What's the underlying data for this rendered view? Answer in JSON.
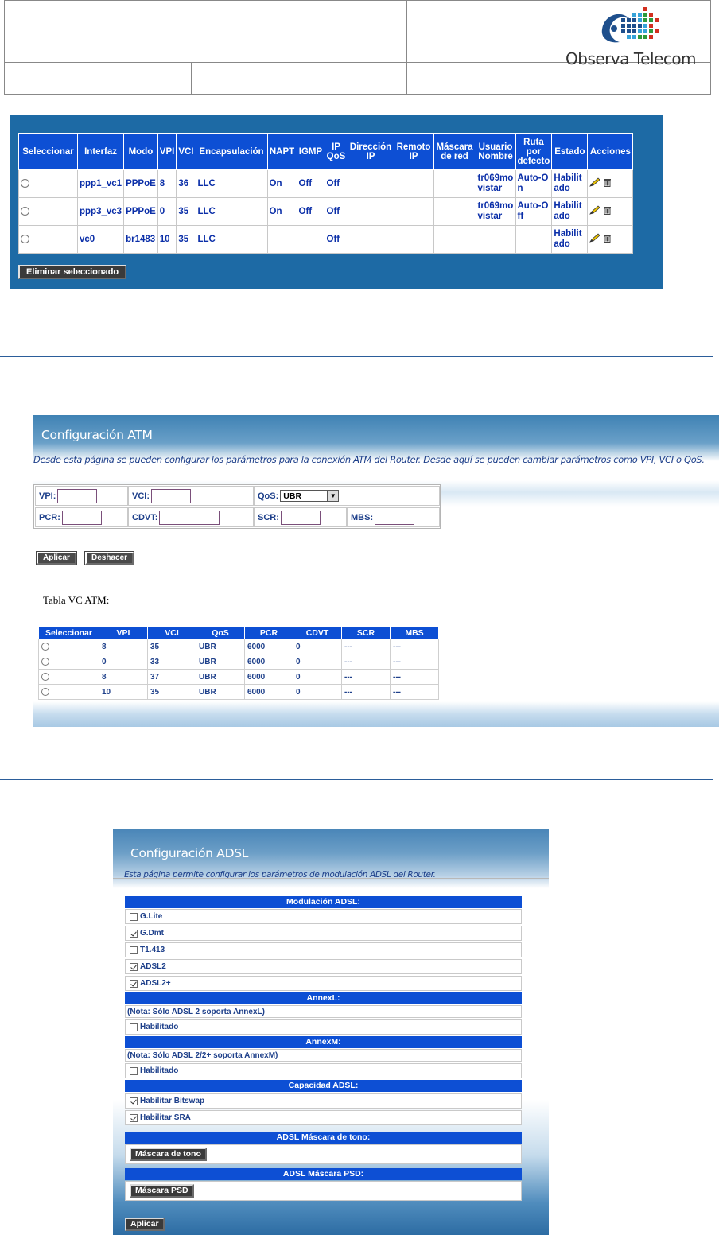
{
  "header": {
    "logo_text": "Observa Telecom",
    "colors": {
      "logo_blue": "#1e4f8c",
      "logo_red": "#d32f1f",
      "logo_green": "#2e9a3a",
      "logo_cyan": "#36a3d9"
    }
  },
  "wan": {
    "columns": [
      "Seleccionar",
      "Interfaz",
      "Modo",
      "VPI",
      "VCI",
      "Encapsulación",
      "NAPT",
      "IGMP",
      "IP QoS",
      "Dirección IP",
      "Remoto IP",
      "Máscara de red",
      "Usuario Nombre",
      "Ruta por defecto",
      "Estado",
      "Acciones"
    ],
    "rows": [
      {
        "interface": "ppp1_vc1",
        "mode": "PPPoE",
        "vpi": "8",
        "vci": "36",
        "encap": "LLC",
        "napt": "On",
        "igmp": "Off",
        "ipqos": "Off",
        "ip": "",
        "remote": "",
        "mask": "",
        "user": "tr069movistar",
        "route": "Auto-On",
        "state": "Habilitado"
      },
      {
        "interface": "ppp3_vc3",
        "mode": "PPPoE",
        "vpi": "0",
        "vci": "35",
        "encap": "LLC",
        "napt": "On",
        "igmp": "Off",
        "ipqos": "Off",
        "ip": "",
        "remote": "",
        "mask": "",
        "user": "tr069movistar",
        "route": "Auto-Off",
        "state": "Habilitado"
      },
      {
        "interface": "vc0",
        "mode": "br1483",
        "vpi": "10",
        "vci": "35",
        "encap": "LLC",
        "napt": "",
        "igmp": "",
        "ipqos": "Off",
        "ip": "",
        "remote": "",
        "mask": "",
        "user": "",
        "route": "",
        "state": "Habilitado"
      }
    ],
    "delete_button": "Eliminar seleccionado"
  },
  "atm": {
    "title": "Configuración ATM",
    "description": "Desde esta página se pueden configurar los parámetros para la conexión ATM del Router. Desde aquí se pueden cambiar parámetros como VPI, VCI o QoS.",
    "labels": {
      "vpi": "VPI:",
      "vci": "VCI:",
      "qos": "QoS:",
      "pcr": "PCR:",
      "cdvt": "CDVT:",
      "scr": "SCR:",
      "mbs": "MBS:"
    },
    "qos_selected": "UBR",
    "apply_button": "Aplicar",
    "undo_button": "Deshacer",
    "table_label": "Tabla VC ATM:",
    "table_columns": [
      "Seleccionar",
      "VPI",
      "VCI",
      "QoS",
      "PCR",
      "CDVT",
      "SCR",
      "MBS"
    ],
    "table_rows": [
      {
        "vpi": "8",
        "vci": "35",
        "qos": "UBR",
        "pcr": "6000",
        "cdvt": "0",
        "scr": "---",
        "mbs": "---"
      },
      {
        "vpi": "0",
        "vci": "33",
        "qos": "UBR",
        "pcr": "6000",
        "cdvt": "0",
        "scr": "---",
        "mbs": "---"
      },
      {
        "vpi": "8",
        "vci": "37",
        "qos": "UBR",
        "pcr": "6000",
        "cdvt": "0",
        "scr": "---",
        "mbs": "---"
      },
      {
        "vpi": "10",
        "vci": "35",
        "qos": "UBR",
        "pcr": "6000",
        "cdvt": "0",
        "scr": "---",
        "mbs": "---"
      }
    ]
  },
  "adsl": {
    "title": "Configuración ADSL",
    "description": "Esta página permite configurar los parámetros de modulación ADSL del Router.",
    "modulation_header": "Modulación ADSL:",
    "modulation": [
      {
        "label": "G.Lite",
        "checked": false
      },
      {
        "label": "G.Dmt",
        "checked": true
      },
      {
        "label": "T1.413",
        "checked": false
      },
      {
        "label": "ADSL2",
        "checked": true
      },
      {
        "label": "ADSL2+",
        "checked": true
      }
    ],
    "annexl_header": "AnnexL:",
    "annexl_note": "(Nota: Sólo ADSL 2 soporta AnnexL)",
    "annexl_enabled_label": "Habilitado",
    "annexm_header": "AnnexM:",
    "annexm_note": "(Nota: Sólo ADSL 2/2+ soporta AnnexM)",
    "annexm_enabled_label": "Habilitado",
    "capacity_header": "Capacidad ADSL:",
    "bitswap_label": "Habilitar Bitswap",
    "sra_label": "Habilitar SRA",
    "tone_header": "ADSL Máscara de tono:",
    "tone_button": "Máscara de tono",
    "psd_header": "ADSL Máscara PSD:",
    "psd_button": "Máscara PSD",
    "apply_button": "Aplicar"
  }
}
